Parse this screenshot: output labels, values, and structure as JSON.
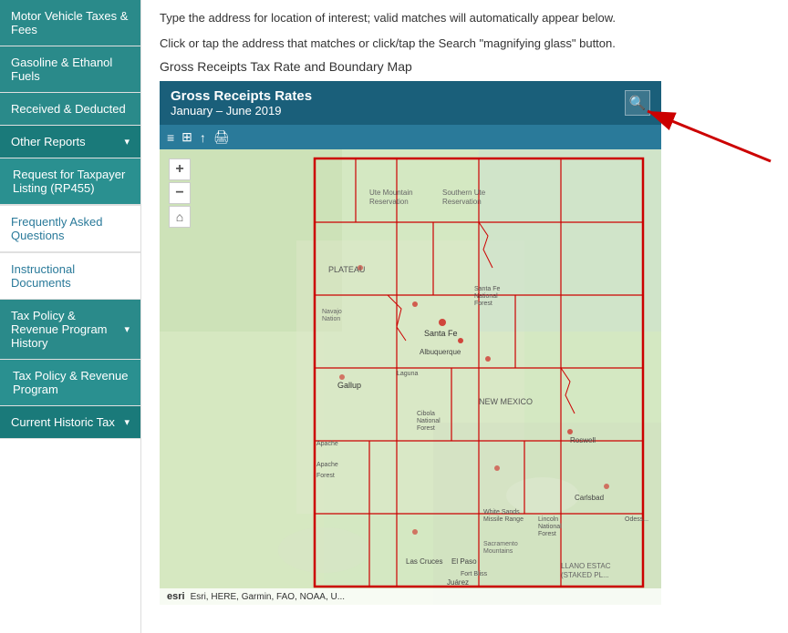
{
  "sidebar": {
    "items": [
      {
        "id": "motor-vehicle",
        "label": "Motor Vehicle Taxes & Fees",
        "type": "active",
        "arrow": false
      },
      {
        "id": "gasoline",
        "label": "Gasoline & Ethanol Fuels",
        "type": "active",
        "arrow": false
      },
      {
        "id": "received-deducted",
        "label": "Received & Deducted",
        "type": "active",
        "arrow": false
      },
      {
        "id": "other-reports",
        "label": "Other Reports",
        "type": "active-dark",
        "arrow": true
      },
      {
        "id": "taxpayer-listing",
        "label": "Request for Taxpayer Listing (RP455)",
        "type": "sub-item",
        "arrow": false
      },
      {
        "id": "faq",
        "label": "Frequently Asked Questions",
        "type": "plain",
        "arrow": false
      },
      {
        "id": "instructional",
        "label": "Instructional Documents",
        "type": "plain",
        "arrow": false
      },
      {
        "id": "tax-policy-history",
        "label": "Tax Policy & Revenue Program History",
        "type": "section-header",
        "arrow": true
      },
      {
        "id": "tax-policy",
        "label": "Tax Policy & Revenue Program",
        "type": "sub-item",
        "arrow": false
      },
      {
        "id": "current-historic",
        "label": "Current Historic Tax",
        "type": "active-dark",
        "arrow": true
      }
    ]
  },
  "main": {
    "instructions": [
      "Type the address for location of interest; valid matches will automatically appear below.",
      "Click or tap the address that matches or click/tap the Search \"magnifying glass\" button."
    ],
    "map_section_title": "Gross Receipts Tax Rate and Boundary Map",
    "map_header": {
      "title": "Gross Receipts Rates",
      "subtitle": "January – June 2019"
    },
    "map_attribution": "Esri, HERE, Garmin, FAO, NOAA, U...",
    "esri_logo": "esri"
  },
  "icons": {
    "search": "🔍",
    "zoom_in": "+",
    "zoom_out": "–",
    "home": "⌂",
    "layer": "≡",
    "print": "🖨",
    "share": "↑",
    "arrow_down": "▾"
  }
}
